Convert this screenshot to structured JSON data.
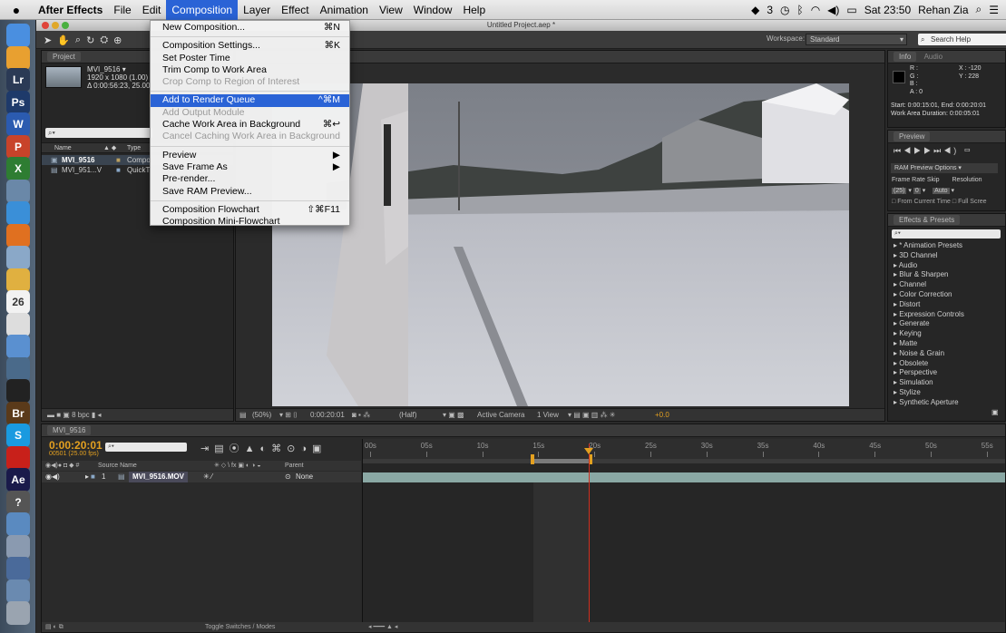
{
  "menubar": {
    "app_name": "After Effects",
    "items": [
      "File",
      "Edit",
      "Composition",
      "Layer",
      "Effect",
      "Animation",
      "View",
      "Window",
      "Help"
    ],
    "active": "Composition",
    "clock": "Sat 23:50",
    "user": "Rehan Zia",
    "status_a": "3"
  },
  "window": {
    "title": "Untitled Project.aep *"
  },
  "workspace": {
    "label": "Workspace:",
    "value": "Standard",
    "search_placeholder": "Search Help"
  },
  "composition_menu": [
    {
      "label": "New Composition...",
      "shortcut": "⌘N",
      "disabled": false
    },
    {
      "sep": true
    },
    {
      "label": "Composition Settings...",
      "shortcut": "⌘K",
      "disabled": false
    },
    {
      "label": "Set Poster Time",
      "shortcut": "",
      "disabled": false
    },
    {
      "label": "Trim Comp to Work Area",
      "shortcut": "",
      "disabled": false
    },
    {
      "label": "Crop Comp to Region of Interest",
      "shortcut": "",
      "disabled": true
    },
    {
      "sep": true
    },
    {
      "label": "Add to Render Queue",
      "shortcut": "^⌘M",
      "disabled": false,
      "highlight": true
    },
    {
      "label": "Add Output Module",
      "shortcut": "",
      "disabled": true
    },
    {
      "label": "Cache Work Area in Background",
      "shortcut": "⌘↩",
      "disabled": false
    },
    {
      "label": "Cancel Caching Work Area in Background",
      "shortcut": "",
      "disabled": true
    },
    {
      "sep": true
    },
    {
      "label": "Preview",
      "shortcut": "▶",
      "disabled": false
    },
    {
      "label": "Save Frame As",
      "shortcut": "▶",
      "disabled": false
    },
    {
      "label": "Pre-render...",
      "shortcut": "",
      "disabled": false
    },
    {
      "label": "Save RAM Preview...",
      "shortcut": "",
      "disabled": false
    },
    {
      "sep": true
    },
    {
      "label": "Composition Flowchart",
      "shortcut": "⇧⌘F11",
      "disabled": false
    },
    {
      "label": "Composition Mini-Flowchart",
      "shortcut": "",
      "disabled": false
    }
  ],
  "project": {
    "tab": "Project",
    "comp_name": "MVI_9516 ▾",
    "comp_res": "1920 x 1080 (1.00)",
    "comp_dur": "Δ 0:00:56:23, 25.00",
    "col_name": "Name",
    "col_type": "Type",
    "items": [
      {
        "name": "MVI_9516",
        "type": "Compo"
      },
      {
        "name": "MVI_951...V",
        "type": "QuickT"
      }
    ],
    "bpc": "8 bpc"
  },
  "info": {
    "tab": "Info",
    "tab2": "Audio",
    "r": "R :",
    "g": "G :",
    "b": "B :",
    "a": "A : 0",
    "x": "X : -120",
    "y": "Y : 228",
    "start": "Start: 0:00:15:01, End: 0:00:20:01",
    "duration": "Work Area Duration: 0:00:05:01"
  },
  "preview": {
    "tab": "Preview",
    "ram_options": "RAM Preview Options",
    "frame_rate": "Frame Rate",
    "skip": "Skip",
    "resolution": "Resolution",
    "fr_val": "(25)",
    "skip_val": "0",
    "res_val": "Auto",
    "from_current": "From Current Time",
    "full_screen": "Full Scree"
  },
  "effects": {
    "tab": "Effects & Presets",
    "items": [
      "* Animation Presets",
      "3D Channel",
      "Audio",
      "Blur & Sharpen",
      "Channel",
      "Color Correction",
      "Distort",
      "Expression Controls",
      "Generate",
      "Keying",
      "Matte",
      "Noise & Grain",
      "Obsolete",
      "Perspective",
      "Simulation",
      "Stylize",
      "Synthetic Aperture"
    ]
  },
  "viewer": {
    "zoom": "(50%)",
    "timecode": "0:00:20:01",
    "resolution": "(Half)",
    "camera": "Active Camera",
    "views": "1 View",
    "exposure": "+0.0"
  },
  "timeline": {
    "tab": "MVI_9516",
    "timecode": "0:00:20:01",
    "fps": "00501 (25.00 fps)",
    "source_name": "Source Name",
    "parent": "Parent",
    "layer_num": "1",
    "layer_name": "MVI_9516.MOV",
    "parent_val": "None",
    "ticks": [
      "00s",
      "05s",
      "10s",
      "15s",
      "20s",
      "25s",
      "30s",
      "35s",
      "40s",
      "45s",
      "50s",
      "55s"
    ],
    "toggle": "Toggle Switches / Modes"
  },
  "dock_icons": [
    {
      "name": "finder-icon",
      "label": "",
      "color": "#4a8fe0"
    },
    {
      "name": "photo-icon",
      "label": "",
      "color": "#e8a030"
    },
    {
      "name": "lightroom-icon",
      "label": "Lr",
      "color": "#2b3a55"
    },
    {
      "name": "photoshop-icon",
      "label": "Ps",
      "color": "#1e3a6a"
    },
    {
      "name": "word-icon",
      "label": "W",
      "color": "#2b5bb0"
    },
    {
      "name": "powerpoint-icon",
      "label": "P",
      "color": "#c8432a"
    },
    {
      "name": "excel-icon",
      "label": "X",
      "color": "#2e7d32"
    },
    {
      "name": "preview-icon",
      "label": "",
      "color": "#6a88a8"
    },
    {
      "name": "safari-icon",
      "label": "",
      "color": "#3a8fd8"
    },
    {
      "name": "firefox-icon",
      "label": "",
      "color": "#e07020"
    },
    {
      "name": "mail-icon",
      "label": "",
      "color": "#8aa8c8"
    },
    {
      "name": "notes-icon",
      "label": "",
      "color": "#e0b040"
    },
    {
      "name": "calendar-icon",
      "label": "26",
      "color": "#f2f2f2"
    },
    {
      "name": "textedit-icon",
      "label": "",
      "color": "#ddd"
    },
    {
      "name": "finder2-icon",
      "label": "",
      "color": "#5a90d0"
    },
    {
      "name": "image-capture-icon",
      "label": "",
      "color": "#4a6a8a"
    },
    {
      "name": "terminal-icon",
      "label": "",
      "color": "#222"
    },
    {
      "name": "bridge-icon",
      "label": "Br",
      "color": "#5a3a1a"
    },
    {
      "name": "skype-icon",
      "label": "S",
      "color": "#1a9ae0"
    },
    {
      "name": "acrobat-icon",
      "label": "",
      "color": "#c8201a"
    },
    {
      "name": "aftereffects-icon",
      "label": "Ae",
      "color": "#1a1a4a"
    },
    {
      "name": "help-icon",
      "label": "?",
      "color": "#555"
    },
    {
      "name": "downloads-icon",
      "label": "",
      "color": "#5a8ac0"
    },
    {
      "name": "documents-icon",
      "label": "",
      "color": "#8a9ab0"
    },
    {
      "name": "apps-icon",
      "label": "",
      "color": "#4a6a9a"
    },
    {
      "name": "folder-icon",
      "label": "",
      "color": "#6a8ab0"
    },
    {
      "name": "trash-icon",
      "label": "",
      "color": "#9aa4b0"
    }
  ],
  "colors": {
    "accent": "#2a63d6",
    "work_area": "#e3a020",
    "playhead": "#d03020",
    "layer_bar": "#8aa8a4",
    "timecode": "#e3a020"
  }
}
